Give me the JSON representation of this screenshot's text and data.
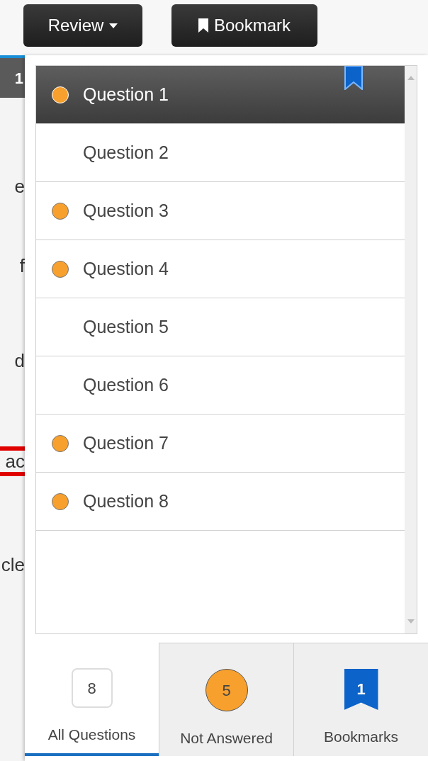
{
  "toolbar": {
    "review_button": "Review",
    "bookmark_button": "Bookmark"
  },
  "background_fragments": [
    {
      "text": "1",
      "kind": "header"
    },
    {
      "text": "e",
      "kind": "text"
    },
    {
      "text": "f",
      "kind": "text"
    },
    {
      "text": "d",
      "kind": "text"
    },
    {
      "text": "ac",
      "kind": "struck"
    },
    {
      "text": "cle",
      "kind": "text"
    }
  ],
  "questions": [
    {
      "label": "Question 1",
      "selected": true,
      "not_answered": true,
      "bookmarked": true
    },
    {
      "label": "Question 2",
      "selected": false,
      "not_answered": false,
      "bookmarked": false
    },
    {
      "label": "Question 3",
      "selected": false,
      "not_answered": true,
      "bookmarked": false
    },
    {
      "label": "Question 4",
      "selected": false,
      "not_answered": true,
      "bookmarked": false
    },
    {
      "label": "Question 5",
      "selected": false,
      "not_answered": false,
      "bookmarked": false
    },
    {
      "label": "Question 6",
      "selected": false,
      "not_answered": false,
      "bookmarked": false
    },
    {
      "label": "Question 7",
      "selected": false,
      "not_answered": true,
      "bookmarked": false
    },
    {
      "label": "Question 8",
      "selected": false,
      "not_answered": true,
      "bookmarked": false
    }
  ],
  "filter_tabs": [
    {
      "kind": "count",
      "count": "8",
      "label": "All Questions",
      "selected": true
    },
    {
      "kind": "dot",
      "count": "5",
      "label": "Not Answered",
      "selected": false
    },
    {
      "kind": "bookmark",
      "count": "1",
      "label": "Bookmarks",
      "selected": false
    }
  ]
}
